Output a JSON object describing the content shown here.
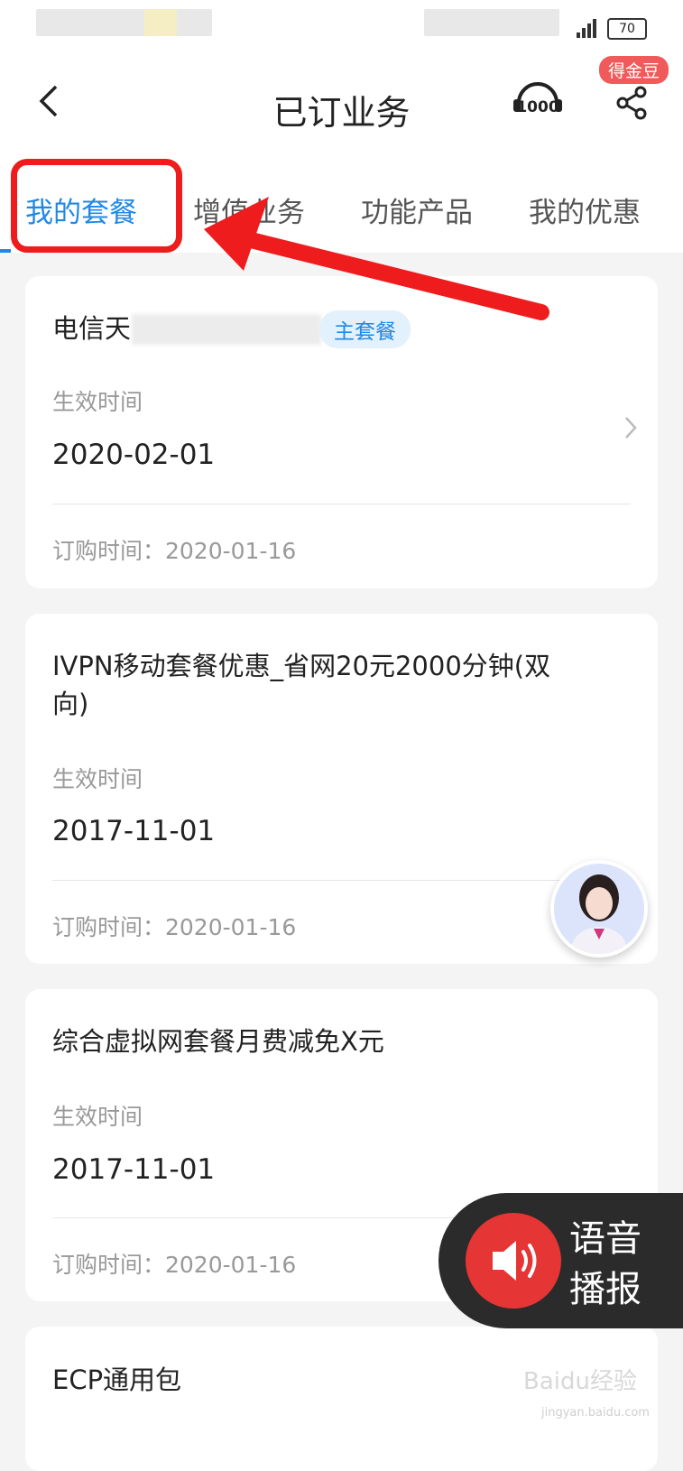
{
  "status": {
    "battery": "70"
  },
  "header": {
    "title": "已订业务",
    "badge": "得金豆",
    "service_icon_text": "1000"
  },
  "tabs": [
    "我的套餐",
    "增值业务",
    "功能产品",
    "我的优惠"
  ],
  "cards": [
    {
      "title": "电信天",
      "tag": "主套餐",
      "effective_label": "生效时间",
      "effective_date": "2020-02-01",
      "order_text": "订购时间：2020-01-16"
    },
    {
      "title": "IVPN移动套餐优惠_省网20元2000分钟(双",
      "title_line2": "向)",
      "effective_label": "生效时间",
      "effective_date": "2017-11-01",
      "order_text": "订购时间：2020-01-16"
    },
    {
      "title": "综合虚拟网套餐月费减免X元",
      "effective_label": "生效时间",
      "effective_date": "2017-11-01",
      "order_text": "订购时间：2020-01-16"
    },
    {
      "title": "ECP通用包"
    }
  ],
  "voice": {
    "line1": "语音",
    "line2": "播报"
  },
  "watermark": {
    "main": "Baidu经验",
    "sub": "jingyan.baidu.com"
  },
  "colors": {
    "accent": "#1f88e5",
    "annotation": "#ee1c1c",
    "voice_button": "#e53535"
  }
}
